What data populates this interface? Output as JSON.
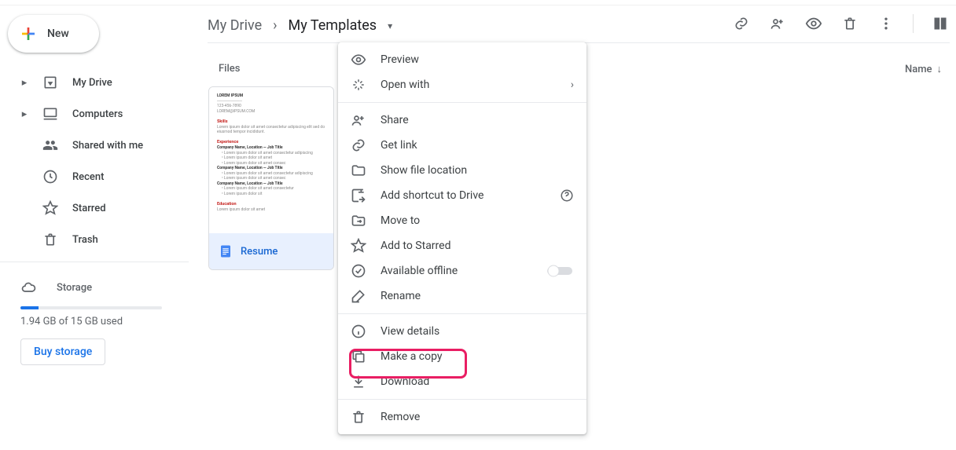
{
  "sidebar": {
    "new_label": "New",
    "items": [
      {
        "label": "My Drive"
      },
      {
        "label": "Computers"
      },
      {
        "label": "Shared with me"
      },
      {
        "label": "Recent"
      },
      {
        "label": "Starred"
      },
      {
        "label": "Trash"
      }
    ],
    "storage_label": "Storage",
    "quota_text": "1.94 GB of 15 GB used",
    "buy_label": "Buy storage"
  },
  "breadcrumb": {
    "root": "My Drive",
    "current": "My Templates"
  },
  "section_header": "Files",
  "sort_label": "Name",
  "file": {
    "name": "Resume"
  },
  "menu": {
    "preview": "Preview",
    "open_with": "Open with",
    "share": "Share",
    "get_link": "Get link",
    "show_loc": "Show file location",
    "add_shortcut": "Add shortcut to Drive",
    "move_to": "Move to",
    "add_starred": "Add to Starred",
    "offline": "Available offline",
    "rename": "Rename",
    "view_details": "View details",
    "make_copy": "Make a copy",
    "download": "Download",
    "remove": "Remove"
  }
}
